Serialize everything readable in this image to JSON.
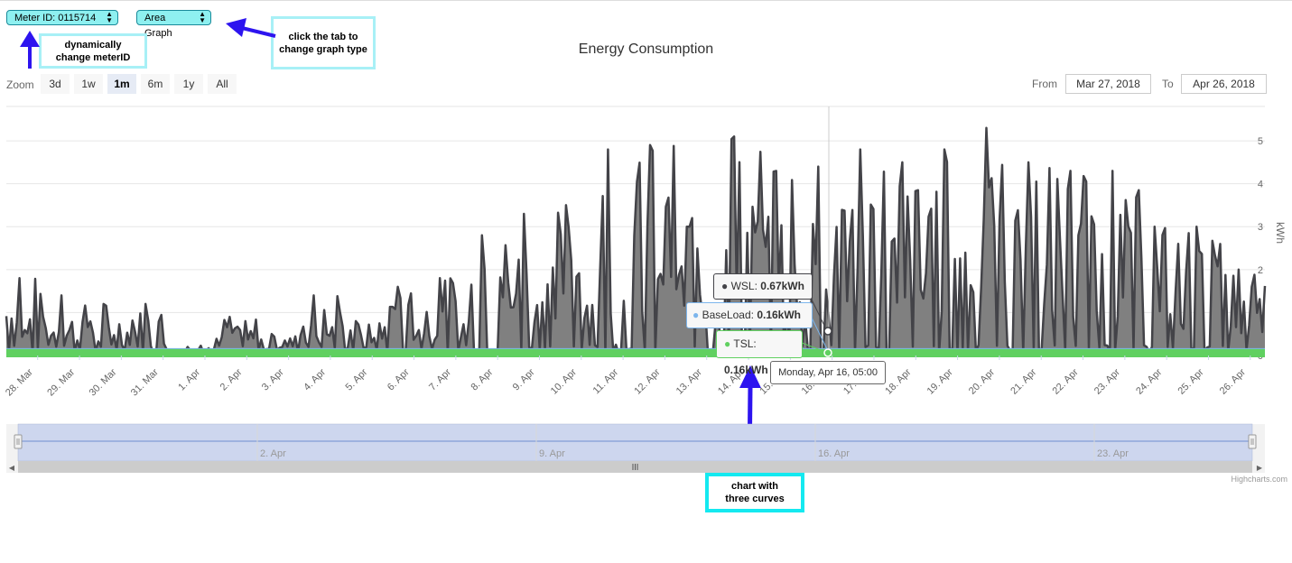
{
  "controls": {
    "meter_select": "Meter ID: 0115714",
    "graph_type_select": "Area Graph"
  },
  "annotations": {
    "meter": "dynamically change meterID",
    "graph_type": "click the tab to change graph type",
    "chart": "chart with three curves"
  },
  "chart_title": "Energy Consumption",
  "zoom": {
    "label": "Zoom",
    "buttons": [
      "3d",
      "1w",
      "1m",
      "6m",
      "1y",
      "All"
    ],
    "active": "1m"
  },
  "range": {
    "from_label": "From",
    "from_value": "Mar 27, 2018",
    "to_label": "To",
    "to_value": "Apr 26, 2018"
  },
  "tooltip": {
    "wsl_label": "WSL",
    "wsl_value": "0.67kWh",
    "baseload_label": "BaseLoad",
    "baseload_value": "0.16kWh",
    "tsl_label": "TSL",
    "tsl_value": "0.16kWh",
    "timestamp": "Monday, Apr 16, 05:00"
  },
  "navigator_labels": [
    "2. Apr",
    "9. Apr",
    "16. Apr",
    "23. Apr"
  ],
  "credits": "Highcharts.com",
  "colors": {
    "wsl": "#434348",
    "wsl_fill": "#808080",
    "baseload": "#7cb5ec",
    "tsl": "#60d060",
    "navigator_fill": "#cdd6ee",
    "annotation_border": "#14e9f0",
    "arrow": "#2d14ef"
  },
  "chart_data": {
    "type": "area",
    "title": "Energy Consumption",
    "ylabel": "kWh",
    "ylim": [
      0,
      5.8
    ],
    "yticks": [
      0,
      1,
      2,
      3,
      4,
      5
    ],
    "ytick_labels": [
      "0",
      "1",
      "2",
      "3",
      "4",
      "5"
    ],
    "x_tick_labels": [
      "28. Mar",
      "29. Mar",
      "30. Mar",
      "31. Mar",
      "1. Apr",
      "2. Apr",
      "3. Apr",
      "4. Apr",
      "5. Apr",
      "6. Apr",
      "7. Apr",
      "8. Apr",
      "9. Apr",
      "10. Apr",
      "11. Apr",
      "12. Apr",
      "13. Apr",
      "14. Apr",
      "15. Apr",
      "16. Apr",
      "17. Apr",
      "18. Apr",
      "19. Apr",
      "20. Apr",
      "21. Apr",
      "22. Apr",
      "23. Apr",
      "24. Apr",
      "25. Apr",
      "26. Apr"
    ],
    "x_start": "Mar 27, 2018",
    "x_end": "Apr 26, 2018",
    "series": [
      {
        "name": "WSL",
        "peak_values_per_day": [
          1.8,
          1.4,
          1.2,
          1.2,
          0.2,
          0.9,
          0.5,
          1.4,
          0.8,
          1.6,
          1.8,
          2.8,
          3.3,
          3.5,
          4.8,
          4.9,
          3.2,
          5.1,
          4.3,
          4.4,
          4.8,
          4.5,
          4.8,
          5.3,
          4.5,
          4.3,
          4.3,
          3.0,
          3.0,
          2.0
        ]
      },
      {
        "name": "BaseLoad",
        "value": 0.16
      },
      {
        "name": "TSL",
        "value": 0.16
      }
    ],
    "highlighted_point": {
      "x": "Monday, Apr 16, 05:00",
      "WSL": 0.67,
      "BaseLoad": 0.16,
      "TSL": 0.16
    }
  }
}
